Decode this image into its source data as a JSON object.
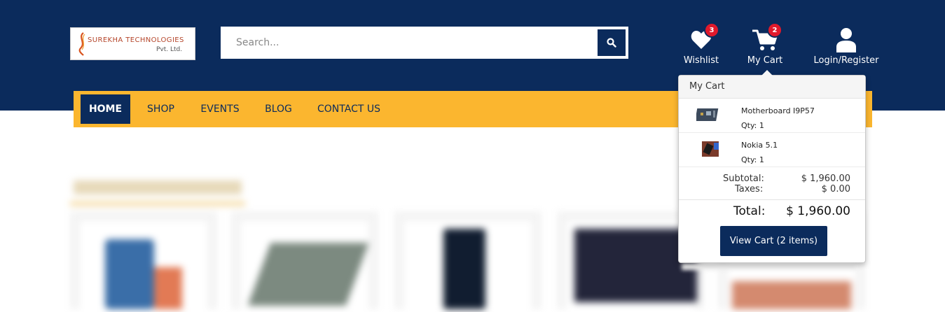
{
  "header": {
    "logo": {
      "company": "SUREKHA TECHNOLOGIES",
      "suffix": "Pvt. Ltd."
    },
    "search": {
      "placeholder": "Search...",
      "icon": "search-icon"
    },
    "wishlist": {
      "label": "Wishlist",
      "count": "3",
      "icon": "heart-icon"
    },
    "cart": {
      "label": "My Cart",
      "count": "2",
      "icon": "cart-icon"
    },
    "account": {
      "label": "Login/Register",
      "icon": "user-icon"
    }
  },
  "nav": {
    "items": [
      {
        "label": "HOME",
        "active": true
      },
      {
        "label": "SHOP"
      },
      {
        "label": "EVENTS"
      },
      {
        "label": "BLOG"
      },
      {
        "label": "CONTACT US"
      }
    ]
  },
  "cart_dropdown": {
    "title": "My Cart",
    "items": [
      {
        "name": "Motherboard I9P57",
        "qty": "Qty: 1"
      },
      {
        "name": "Nokia 5.1",
        "qty": "Qty: 1"
      }
    ],
    "subtotal_label": "Subtotal:",
    "subtotal_value": "$ 1,960.00",
    "taxes_label": "Taxes:",
    "taxes_value": "$ 0.00",
    "total_label": "Total:",
    "total_value": "$ 1,960.00",
    "view_cart_label": "View Cart (2 items)"
  },
  "colors": {
    "primary": "#0b2b5c",
    "accent": "#fbb62f",
    "badge": "#e0192b"
  }
}
